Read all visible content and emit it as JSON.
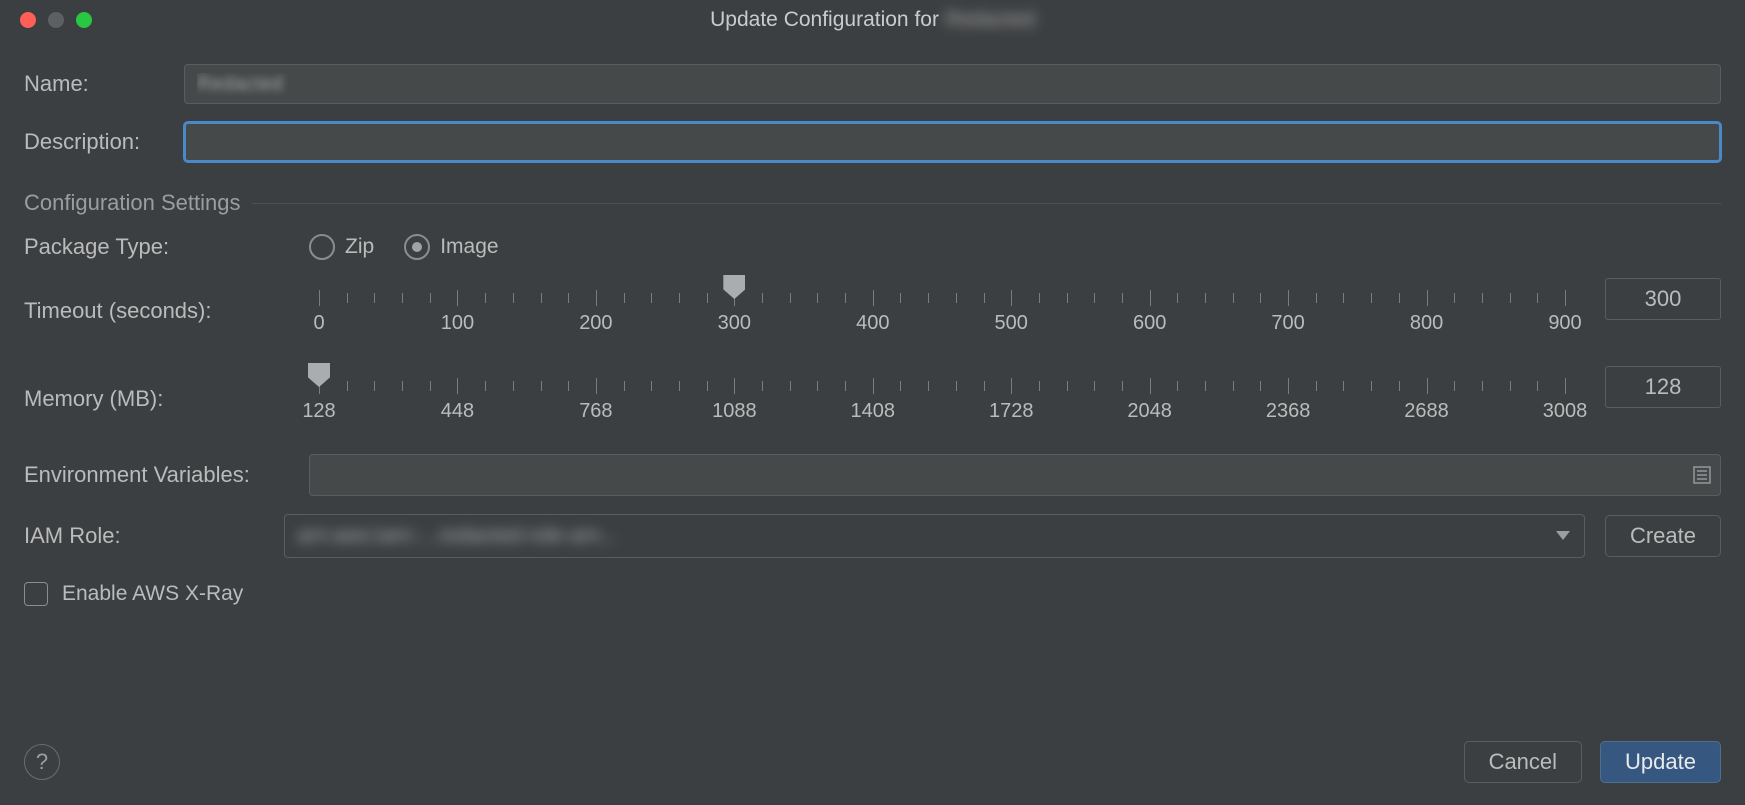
{
  "window": {
    "title_prefix": "Update Configuration for",
    "title_subject": "Redacted"
  },
  "labels": {
    "name": "Name:",
    "description": "Description:",
    "section": "Configuration Settings",
    "package_type": "Package Type:",
    "timeout": "Timeout (seconds):",
    "memory": "Memory (MB):",
    "env_vars": "Environment Variables:",
    "iam_role": "IAM Role:",
    "xray": "Enable AWS X-Ray"
  },
  "fields": {
    "name_value": "Redacted",
    "description_value": "",
    "env_value": "",
    "iam_selected": "arn:aws:iam::...redacted-role-arn..."
  },
  "package_type": {
    "options": [
      "Zip",
      "Image"
    ],
    "selected": "Image"
  },
  "timeout": {
    "min": 0,
    "max": 900,
    "step_major": 100,
    "value": 300,
    "ticks": [
      0,
      100,
      200,
      300,
      400,
      500,
      600,
      700,
      800,
      900
    ]
  },
  "memory": {
    "min": 128,
    "max": 3008,
    "value": 128,
    "ticks": [
      128,
      448,
      768,
      1088,
      1408,
      1728,
      2048,
      2368,
      2688,
      3008
    ]
  },
  "xray_enabled": false,
  "buttons": {
    "create": "Create",
    "cancel": "Cancel",
    "update": "Update",
    "help": "?"
  },
  "icons": {
    "list": "list-icon",
    "caret": "chevron-down-icon"
  }
}
